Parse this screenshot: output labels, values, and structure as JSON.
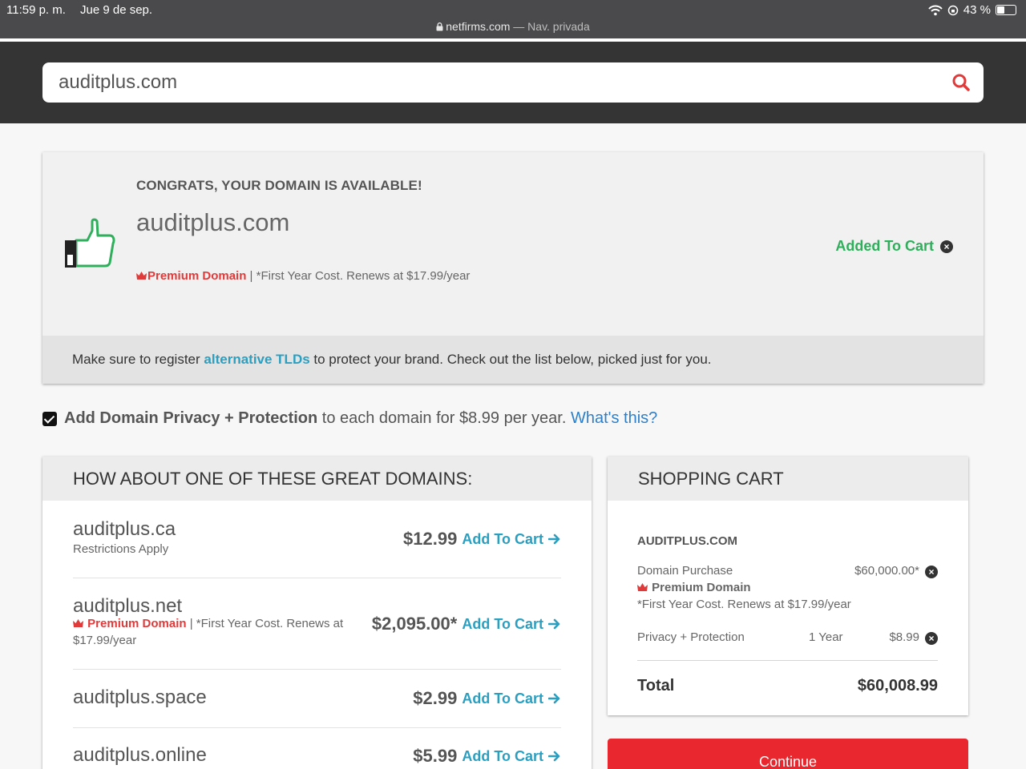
{
  "status_bar": {
    "time": "11:59 p. m.",
    "date": "Jue 9 de sep.",
    "url": "netfirms.com",
    "mode": "— Nav. privada",
    "battery": "43 %"
  },
  "search": {
    "value": "auditplus.com"
  },
  "availability": {
    "headline": "CONGRATS, YOUR DOMAIN IS AVAILABLE!",
    "domain": "auditplus.com",
    "premium_label": "Premium Domain",
    "renew_note": " | *First Year Cost. Renews at $17.99/year",
    "added_label": "Added To Cart",
    "tld_prefix": "Make sure to register ",
    "tld_link": "alternative TLDs",
    "tld_suffix": " to protect your brand. Check out the list below, picked just for you."
  },
  "privacy": {
    "checked": true,
    "bold": "Add Domain Privacy + Protection",
    "text": " to each domain for $8.99 per year. ",
    "link": "What's this?"
  },
  "suggestions": {
    "title": "HOW ABOUT ONE OF THESE GREAT DOMAINS:",
    "add_label": "Add To Cart",
    "items": [
      {
        "domain": "auditplus.ca",
        "note": "Restrictions Apply",
        "price": "$12.99"
      },
      {
        "domain": "auditplus.net",
        "premium_label": "Premium Domain",
        "note": " | *First Year Cost. Renews at",
        "note2": "$17.99/year",
        "price": "$2,095.00*"
      },
      {
        "domain": "auditplus.space",
        "price": "$2.99"
      },
      {
        "domain": "auditplus.online",
        "price": "$5.99"
      }
    ]
  },
  "cart": {
    "title": "SHOPPING CART",
    "item_title": "AUDITPLUS.COM",
    "purchase_label": "Domain Purchase",
    "purchase_price": "$60,000.00*",
    "premium_label": "Premium Domain",
    "renew_note": "*First Year Cost. Renews at $17.99/year",
    "privacy_label": "Privacy + Protection",
    "privacy_term": "1 Year",
    "privacy_price": "$8.99",
    "total_label": "Total",
    "total_value": "$60,008.99",
    "continue_label": "Continue"
  },
  "colors": {
    "header_bg": "#343434",
    "accent_red": "#e8282e",
    "link_teal": "#2b9fc0",
    "added_green": "#2fae5b",
    "premium_red": "#e03a3a"
  }
}
